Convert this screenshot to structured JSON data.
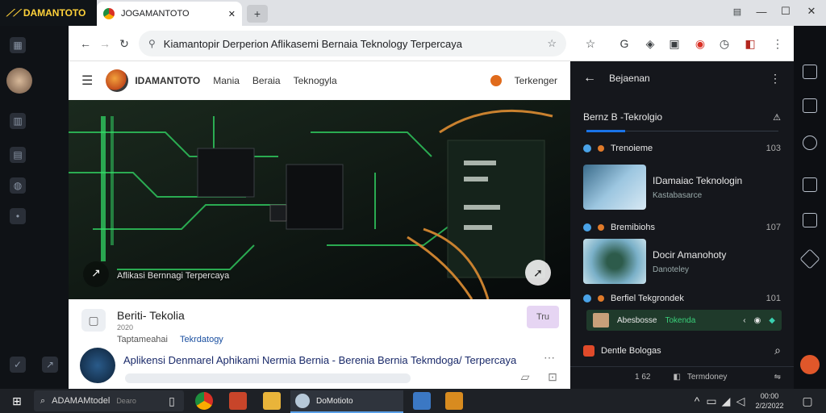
{
  "app": {
    "brand": "DAMANTOTO"
  },
  "tabs": [
    {
      "title": "JOGAMANTOTO",
      "close": "✕"
    }
  ],
  "new_tab": "+",
  "window_controls": {
    "minimize": "—",
    "maximize": "☐",
    "close": "✕"
  },
  "address_bar": {
    "url": "Kiamantopir Derperion Aflikasemi Bernaia Teknology Terpercaya"
  },
  "site": {
    "brand": "IDAMANTOTO",
    "nav": [
      "Mania",
      "Beraia",
      "Teknogyla"
    ],
    "account_label": "Terkenger",
    "hero_caption": "Aflikasi Bernnagi Terpercaya",
    "article": {
      "title": "Beriti- Tekolia",
      "meta1": "2020",
      "meta2": "Taptameahai",
      "meta2_link": "Tekrdatogy",
      "headline": "Aplikensi Denmarel Aphikami Nermia Bernia - Berenia Bernia Tekmdoga/ Terpercaya",
      "cta": "Tru"
    }
  },
  "right_panel": {
    "title": "Bejaenan",
    "section_title": "Bernz  B -Tekrolgio",
    "items": [
      {
        "category": "Trenoieme",
        "count": "103",
        "title": "IDamaiac Teknologin",
        "sub": "Kastabasarce"
      },
      {
        "category": "Bremibiohs",
        "count": "107",
        "title": "Docir Amanohoty",
        "sub": "Danoteley"
      },
      {
        "category": "Berfiel Tekgrondek",
        "count": "101",
        "title": "",
        "sub": ""
      }
    ],
    "strip_labels": [
      "Abesbosse",
      "Tokenda"
    ],
    "footer_item": "Dentle Bologas",
    "bottom_left": "1 62",
    "bottom_mid": "Termdoney"
  },
  "taskbar": {
    "search": "ADAMAMtodel",
    "search_hint": "Dearo",
    "active_app": "DoMotioto",
    "time": "00:00",
    "date": "2/2/2022"
  },
  "colors": {
    "accent": "#1a73e8",
    "hero_green": "#29d05a",
    "panel_bg": "#15171c"
  }
}
